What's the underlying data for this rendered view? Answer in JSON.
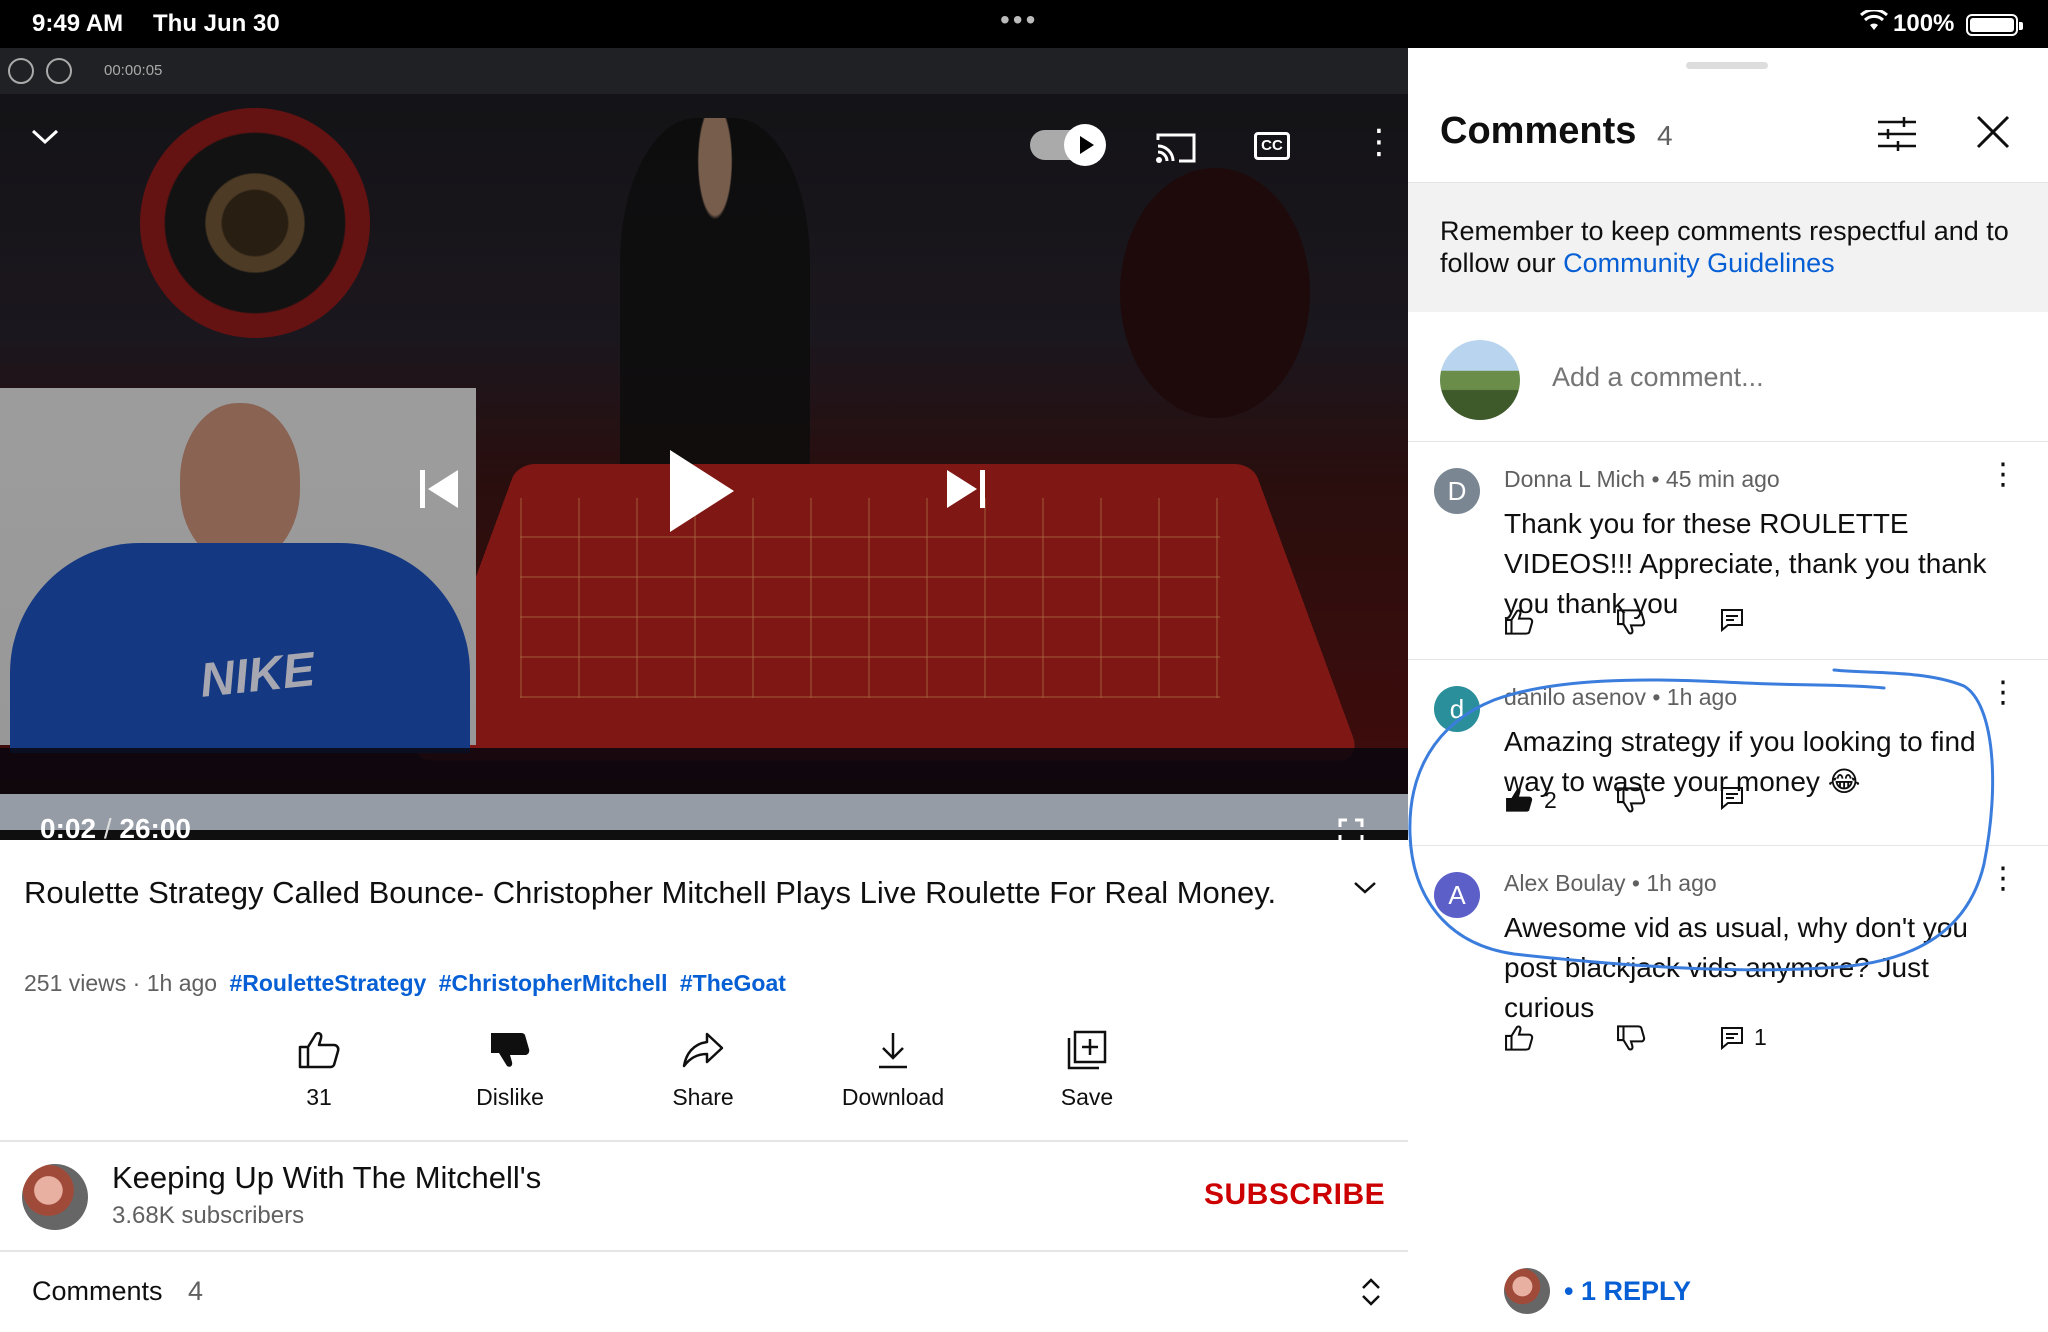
{
  "status_bar": {
    "time": "9:49 AM",
    "date": "Thu Jun 30",
    "battery": "100%"
  },
  "video": {
    "recorder_time": "00:00:05",
    "current_time": "0:02",
    "separator": "/",
    "duration": "26:00",
    "progress": 0.0013,
    "cc_label": "CC",
    "shirt_logo": "NIKE"
  },
  "info": {
    "title": "Roulette Strategy Called Bounce- Christopher Mitchell Plays Live Roulette For Real Money.",
    "views": "251 views",
    "age": "1h ago",
    "hashtags": [
      "#RouletteStrategy",
      "#ChristopherMitchell",
      "#TheGoat"
    ]
  },
  "actions": {
    "like_count": "31",
    "dislike": "Dislike",
    "share": "Share",
    "download": "Download",
    "save": "Save"
  },
  "channel": {
    "name": "Keeping Up With The Mitchell's",
    "subscribers": "3.68K subscribers",
    "subscribe": "SUBSCRIBE"
  },
  "comments_row": {
    "label": "Comments",
    "count": "4"
  },
  "panel": {
    "title": "Comments",
    "count": "4",
    "notice_text": "Remember to keep comments respectful and to follow our",
    "notice_link": "Community Guidelines",
    "add_placeholder": "Add a comment...",
    "comments": [
      {
        "initial": "D",
        "author": "Donna L Mich",
        "age": "45 min ago",
        "text": "Thank you for these ROULETTE VIDEOS!!! Appreciate, thank you thank you thank you",
        "likes": "",
        "replies": "",
        "avatar_color": "#7a8793"
      },
      {
        "initial": "d",
        "author": "danilo asenov",
        "age": "1h ago",
        "text": "Amazing strategy if you looking to find way to waste your money 😂",
        "likes": "2",
        "replies": "",
        "avatar_color": "#2a8f9a"
      },
      {
        "initial": "A",
        "author": "Alex Boulay",
        "age": "1h ago",
        "text": "Awesome vid as usual, why don't you post blackjack vids anymore? Just curious",
        "likes": "",
        "replies": "1",
        "avatar_color": "#5b5fc7"
      }
    ],
    "reply_link": "• 1 REPLY"
  },
  "colors": {
    "accent_blue": "#065fd4",
    "subscribe_red": "#cc0000",
    "progress_red": "#ff0000",
    "annotation": "#3b7ddd"
  }
}
